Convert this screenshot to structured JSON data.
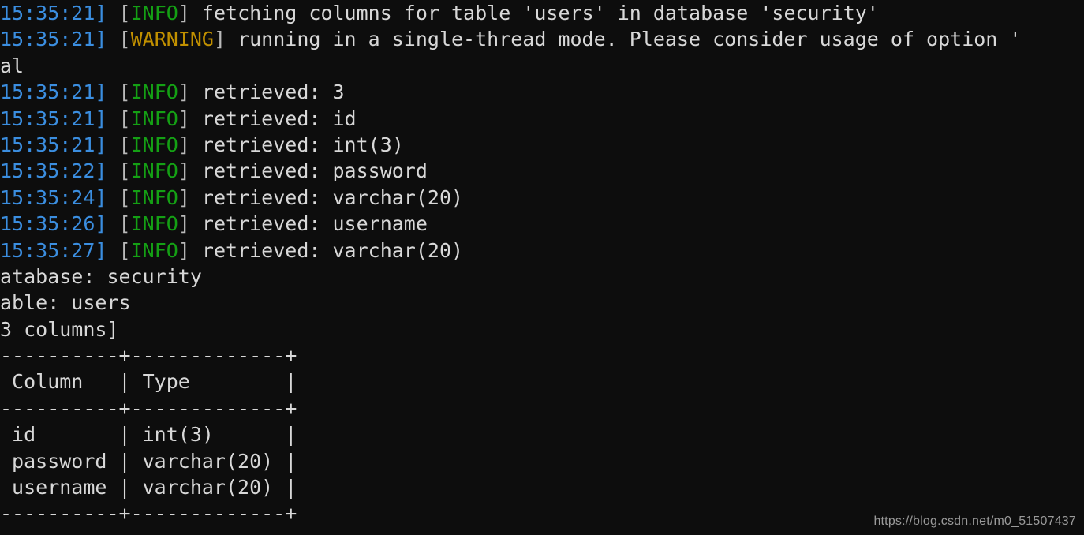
{
  "terminal": {
    "background_color": "#0d0d0d",
    "default_text_color": "#d8d8d8",
    "timestamp_color": "#3b8ee0",
    "info_color": "#14a014",
    "warning_color": "#c19000",
    "bracket_color": "#b9b9b9",
    "lines": [
      {
        "kind": "log",
        "timestamp": "15:35:21]",
        "level": "INFO",
        "message": " fetching columns for table 'users' in database 'security'"
      },
      {
        "kind": "log",
        "timestamp": "15:35:21]",
        "level": "WARNING",
        "message": " running in a single-thread mode. Please consider usage of option '"
      },
      {
        "kind": "plain",
        "text": "al"
      },
      {
        "kind": "log",
        "timestamp": "15:35:21]",
        "level": "INFO",
        "message": " retrieved: 3"
      },
      {
        "kind": "log",
        "timestamp": "15:35:21]",
        "level": "INFO",
        "message": " retrieved: id"
      },
      {
        "kind": "log",
        "timestamp": "15:35:21]",
        "level": "INFO",
        "message": " retrieved: int(3)"
      },
      {
        "kind": "log",
        "timestamp": "15:35:22]",
        "level": "INFO",
        "message": " retrieved: password"
      },
      {
        "kind": "log",
        "timestamp": "15:35:24]",
        "level": "INFO",
        "message": " retrieved: varchar(20)"
      },
      {
        "kind": "log",
        "timestamp": "15:35:26]",
        "level": "INFO",
        "message": " retrieved: username"
      },
      {
        "kind": "log",
        "timestamp": "15:35:27]",
        "level": "INFO",
        "message": " retrieved: varchar(20)"
      },
      {
        "kind": "plain",
        "text": "atabase: security"
      },
      {
        "kind": "plain",
        "text": "able: users"
      },
      {
        "kind": "plain",
        "text": "3 columns]"
      },
      {
        "kind": "table",
        "text": "----------+-------------+"
      },
      {
        "kind": "table",
        "text": " Column   | Type        |"
      },
      {
        "kind": "table",
        "text": "----------+-------------+"
      },
      {
        "kind": "table",
        "text": " id       | int(3)      |"
      },
      {
        "kind": "table",
        "text": " password | varchar(20) |"
      },
      {
        "kind": "table",
        "text": " username | varchar(20) |"
      },
      {
        "kind": "table",
        "text": "----------+-------------+"
      }
    ],
    "result_table": {
      "headers": [
        "Column",
        "Type"
      ],
      "rows": [
        [
          "id",
          "int(3)"
        ],
        [
          "password",
          "varchar(20)"
        ],
        [
          "username",
          "varchar(20)"
        ]
      ],
      "database": "security",
      "table_name": "users",
      "column_count": "3 columns"
    }
  },
  "watermark": {
    "text": "https://blog.csdn.net/m0_51507437"
  }
}
